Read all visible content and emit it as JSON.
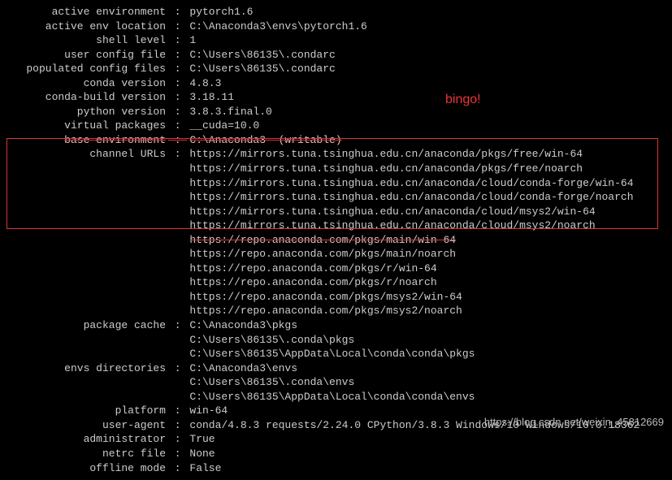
{
  "rows": [
    {
      "label": "active environment",
      "values": [
        "pytorch1.6"
      ]
    },
    {
      "label": "active env location",
      "values": [
        "C:\\Anaconda3\\envs\\pytorch1.6"
      ]
    },
    {
      "label": "shell level",
      "values": [
        "1"
      ]
    },
    {
      "label": "user config file",
      "values": [
        "C:\\Users\\86135\\.condarc"
      ]
    },
    {
      "label": "populated config files",
      "values": [
        "C:\\Users\\86135\\.condarc"
      ]
    },
    {
      "label": "conda version",
      "values": [
        "4.8.3"
      ]
    },
    {
      "label": "conda-build version",
      "values": [
        "3.18.11"
      ]
    },
    {
      "label": "python version",
      "values": [
        "3.8.3.final.0"
      ]
    },
    {
      "label": "virtual packages",
      "values": [
        "__cuda=10.0"
      ]
    },
    {
      "label": "base environment",
      "values": [
        "C:\\Anaconda3  (writable)"
      ],
      "struck": true
    },
    {
      "label": "channel URLs",
      "values": [
        "https://mirrors.tuna.tsinghua.edu.cn/anaconda/pkgs/free/win-64",
        "https://mirrors.tuna.tsinghua.edu.cn/anaconda/pkgs/free/noarch",
        "https://mirrors.tuna.tsinghua.edu.cn/anaconda/cloud/conda-forge/win-64",
        "https://mirrors.tuna.tsinghua.edu.cn/anaconda/cloud/conda-forge/noarch",
        "https://mirrors.tuna.tsinghua.edu.cn/anaconda/cloud/msys2/win-64",
        "https://mirrors.tuna.tsinghua.edu.cn/anaconda/cloud/msys2/noarch",
        "https://repo.anaconda.com/pkgs/main/win-64",
        "https://repo.anaconda.com/pkgs/main/noarch",
        "https://repo.anaconda.com/pkgs/r/win-64",
        "https://repo.anaconda.com/pkgs/r/noarch",
        "https://repo.anaconda.com/pkgs/msys2/win-64",
        "https://repo.anaconda.com/pkgs/msys2/noarch"
      ],
      "struck_value_idx": 6
    },
    {
      "label": "package cache",
      "values": [
        "C:\\Anaconda3\\pkgs",
        "C:\\Users\\86135\\.conda\\pkgs",
        "C:\\Users\\86135\\AppData\\Local\\conda\\conda\\pkgs"
      ]
    },
    {
      "label": "envs directories",
      "values": [
        "C:\\Anaconda3\\envs",
        "C:\\Users\\86135\\.conda\\envs",
        "C:\\Users\\86135\\AppData\\Local\\conda\\conda\\envs"
      ]
    },
    {
      "label": "platform",
      "values": [
        "win-64"
      ]
    },
    {
      "label": "user-agent",
      "values": [
        "conda/4.8.3 requests/2.24.0 CPython/3.8.3 Windows/10 Windows/10.0.18362"
      ]
    },
    {
      "label": "administrator",
      "values": [
        "True"
      ]
    },
    {
      "label": "netrc file",
      "values": [
        "None"
      ]
    },
    {
      "label": "offline mode",
      "values": [
        "False"
      ]
    }
  ],
  "annotation": "bingo!",
  "watermark": "https://blog.csdn.net/weixin_45812669"
}
